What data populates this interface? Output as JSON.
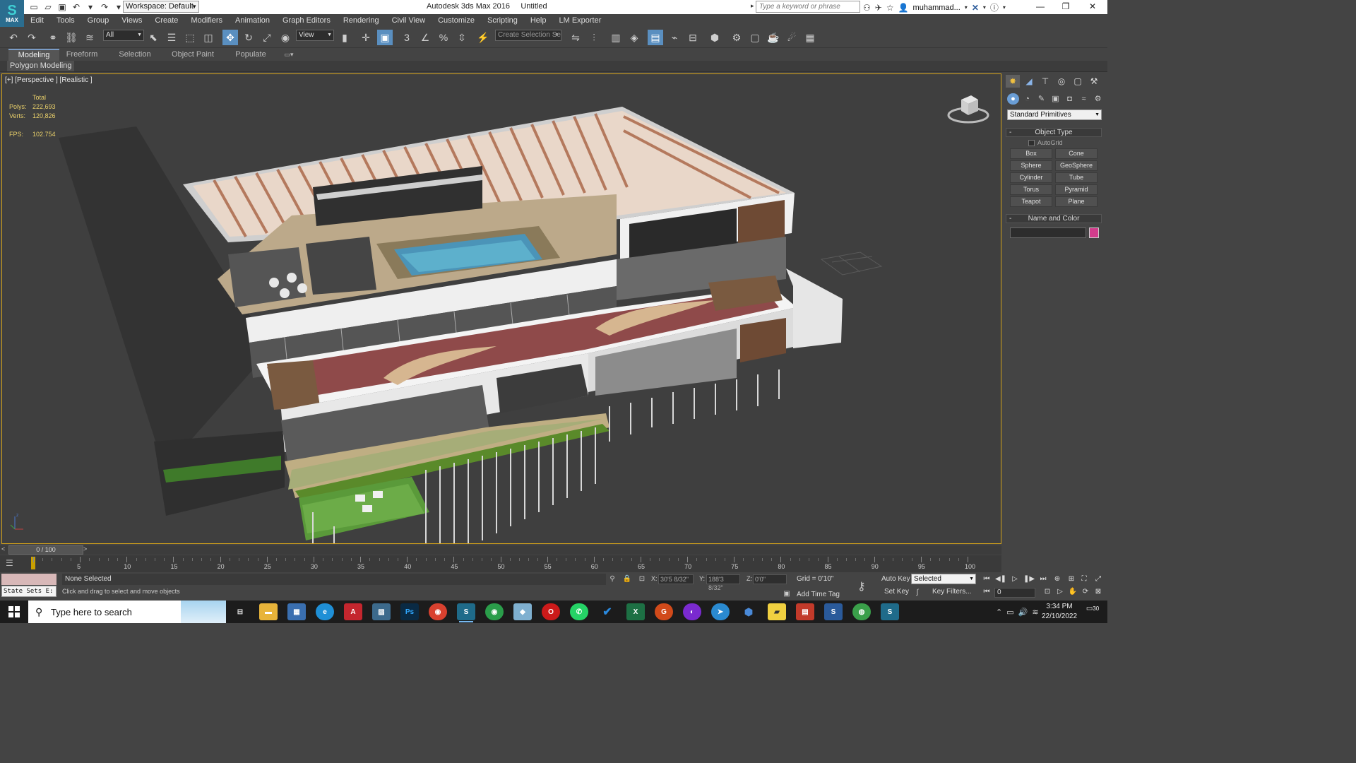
{
  "titlebar": {
    "logo_text": "MAX",
    "workspace": "Workspace: Default",
    "title": "Autodesk 3ds Max 2016",
    "document": "Untitled",
    "search_placeholder": "Type a keyword or phrase",
    "user": "muhammad..."
  },
  "menu": [
    "Edit",
    "Tools",
    "Group",
    "Views",
    "Create",
    "Modifiers",
    "Animation",
    "Graph Editors",
    "Rendering",
    "Civil View",
    "Customize",
    "Scripting",
    "Help",
    "LM Exporter"
  ],
  "toolbar": {
    "filter_value": "All",
    "refcoord_value": "View",
    "selection_set_placeholder": "Create Selection Se",
    "snap_label": "3"
  },
  "ribbon": {
    "tabs": [
      "Modeling",
      "Freeform",
      "Selection",
      "Object Paint",
      "Populate"
    ],
    "active_tab": "Modeling",
    "panel_label": "Polygon Modeling"
  },
  "viewport": {
    "label": "[+] [Perspective ] [Realistic ]",
    "stats_header": "Total",
    "polys_label": "Polys:",
    "polys_value": "222,693",
    "verts_label": "Verts:",
    "verts_value": "120,826",
    "fps_label": "FPS:",
    "fps_value": "102.754"
  },
  "command_panel": {
    "category": "Standard Primitives",
    "object_type_header": "Object Type",
    "autogrid": "AutoGrid",
    "buttons": [
      "Box",
      "Cone",
      "Sphere",
      "GeoSphere",
      "Cylinder",
      "Tube",
      "Torus",
      "Pyramid",
      "Teapot",
      "Plane"
    ],
    "name_color_header": "Name and Color",
    "object_color": "#d23c8c"
  },
  "timeline": {
    "frame_display": "0 / 100",
    "ticks": [
      "5",
      "10",
      "15",
      "20",
      "25",
      "30",
      "35",
      "40",
      "45",
      "50",
      "55",
      "60",
      "65",
      "70",
      "75",
      "80",
      "85",
      "90",
      "95",
      "100"
    ]
  },
  "status": {
    "maxscript_label": "State Sets E:",
    "selection": "None Selected",
    "prompt": "Click and drag to select and move objects",
    "x_label": "X:",
    "x_value": "30'5 8/32\"",
    "y_label": "Y:",
    "y_value": "188'3 8/32\"",
    "z_label": "Z:",
    "z_value": "0'0\"",
    "grid": "Grid = 0'10\"",
    "add_time_tag": "Add Time Tag",
    "auto_key": "Auto Key",
    "set_key": "Set Key",
    "key_mode": "Selected",
    "key_filters": "Key Filters...",
    "current_frame": "0"
  },
  "taskbar": {
    "search_placeholder": "Type here to search",
    "time": "3:34 PM",
    "date": "22/10/2022",
    "notifications": "30"
  }
}
